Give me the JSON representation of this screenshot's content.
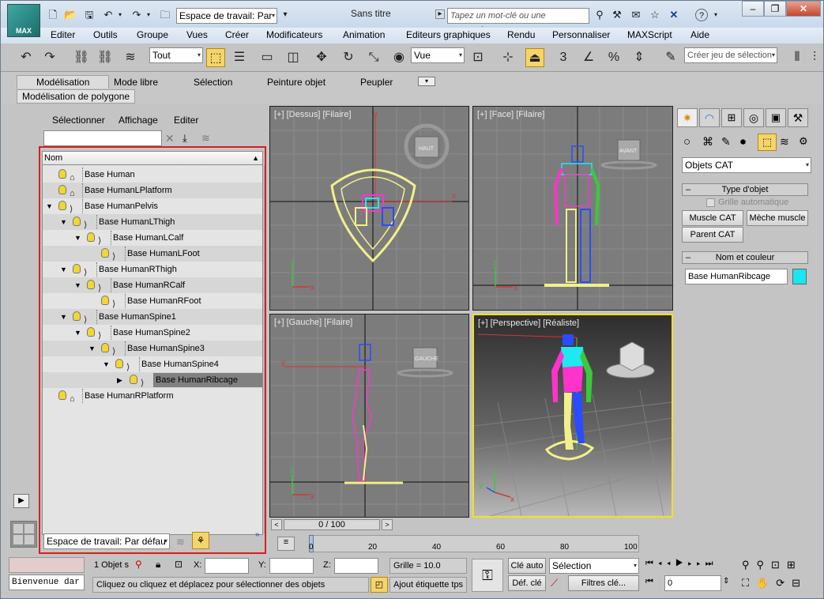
{
  "window": {
    "title": "Sans titre",
    "workspace_combo": "Espace de travail: Par",
    "search_placeholder": "Tapez un mot-clé ou une expression",
    "logo_text": "MAX"
  },
  "menu": [
    "Editer",
    "Outils",
    "Groupe",
    "Vues",
    "Créer",
    "Modificateurs",
    "Animation",
    "Editeurs graphiques",
    "Rendu",
    "Personnaliser",
    "MAXScript",
    "Aide"
  ],
  "toolbar": {
    "selection_filter": "Tout",
    "ref_coord": "Vue",
    "named_selection_placeholder": "Créer jeu de sélection",
    "snap_labels": [
      "3",
      "%",
      "n"
    ]
  },
  "ribbon": {
    "tabs": [
      "Modélisation",
      "Mode libre",
      "Sélection",
      "Peinture objet",
      "Peupler"
    ],
    "subtab": "Modélisation de polygone"
  },
  "explorer": {
    "menus": [
      "Sélectionner",
      "Affichage",
      "Editer"
    ],
    "column_header": "Nom",
    "rows": [
      {
        "label": "Base Human",
        "indent": 0,
        "kind": "platform",
        "expand": ""
      },
      {
        "label": "Base HumanLPlatform",
        "indent": 0,
        "kind": "platform",
        "expand": ""
      },
      {
        "label": "Base HumanPelvis",
        "indent": 0,
        "kind": "bone",
        "expand": "▼"
      },
      {
        "label": "Base HumanLThigh",
        "indent": 1,
        "kind": "bone",
        "expand": "▼"
      },
      {
        "label": "Base HumanLCalf",
        "indent": 2,
        "kind": "bone",
        "expand": "▼"
      },
      {
        "label": "Base HumanLFoot",
        "indent": 3,
        "kind": "bone",
        "expand": ""
      },
      {
        "label": "Base HumanRThigh",
        "indent": 1,
        "kind": "bone",
        "expand": "▼"
      },
      {
        "label": "Base HumanRCalf",
        "indent": 2,
        "kind": "bone",
        "expand": "▼"
      },
      {
        "label": "Base HumanRFoot",
        "indent": 3,
        "kind": "bone",
        "expand": ""
      },
      {
        "label": "Base HumanSpine1",
        "indent": 1,
        "kind": "bone",
        "expand": "▼"
      },
      {
        "label": "Base HumanSpine2",
        "indent": 2,
        "kind": "bone",
        "expand": "▼"
      },
      {
        "label": "Base HumanSpine3",
        "indent": 3,
        "kind": "bone",
        "expand": "▼"
      },
      {
        "label": "Base HumanSpine4",
        "indent": 4,
        "kind": "bone",
        "expand": "▼"
      },
      {
        "label": "Base HumanRibcage",
        "indent": 5,
        "kind": "bone",
        "expand": "▶",
        "selected": true
      },
      {
        "label": "Base HumanRPlatform",
        "indent": 0,
        "kind": "platform",
        "expand": ""
      }
    ],
    "workspace_footer": "Espace de travail: Par défau",
    "expand_glyph": "»"
  },
  "viewports": {
    "top": {
      "label": "[+] [Dessus] [Filaire]",
      "cube": "HAUT"
    },
    "front": {
      "label": "[+] [Face] [Filaire]",
      "cube": "AVANT"
    },
    "left": {
      "label": "[+] [Gauche] [Filaire]",
      "cube": "GAUCHE"
    },
    "persp": {
      "label": "[+] [Perspective] [Réaliste]"
    }
  },
  "axis_labels": {
    "x": "x",
    "y": "y",
    "z": "z"
  },
  "command_panel": {
    "category": "Objets CAT",
    "object_type_header": "Type d'objet",
    "auto_grid": "Grille automatique",
    "buttons": [
      "Muscle CAT",
      "Mèche muscle",
      "Parent CAT"
    ],
    "name_color_header": "Nom et couleur",
    "object_name": "Base HumanRibcage",
    "object_color": "#19e6f0"
  },
  "timeline": {
    "frame": "0 / 100",
    "ticks": [
      "0",
      "20",
      "40",
      "60",
      "80",
      "100"
    ]
  },
  "status": {
    "objects_selected": "1 Objet s",
    "x_label": "X:",
    "y_label": "Y:",
    "z_label": "Z:",
    "grid": "Grille = 10.0",
    "auto_key": "Clé auto",
    "set_key": "Déf. clé",
    "key_mode": "Sélection",
    "key_filters": "Filtres clé...",
    "current_frame": "0",
    "welcome": "Bienvenue dar",
    "prompt": "Cliquez ou cliquez et déplacez pour sélectionner des objets",
    "add_time_tag": "Ajout étiquette tps"
  },
  "colors": {
    "selection_outline": "#d42020",
    "active_viewport": "#f2e21a",
    "highlight_button": "#f5d56a"
  }
}
